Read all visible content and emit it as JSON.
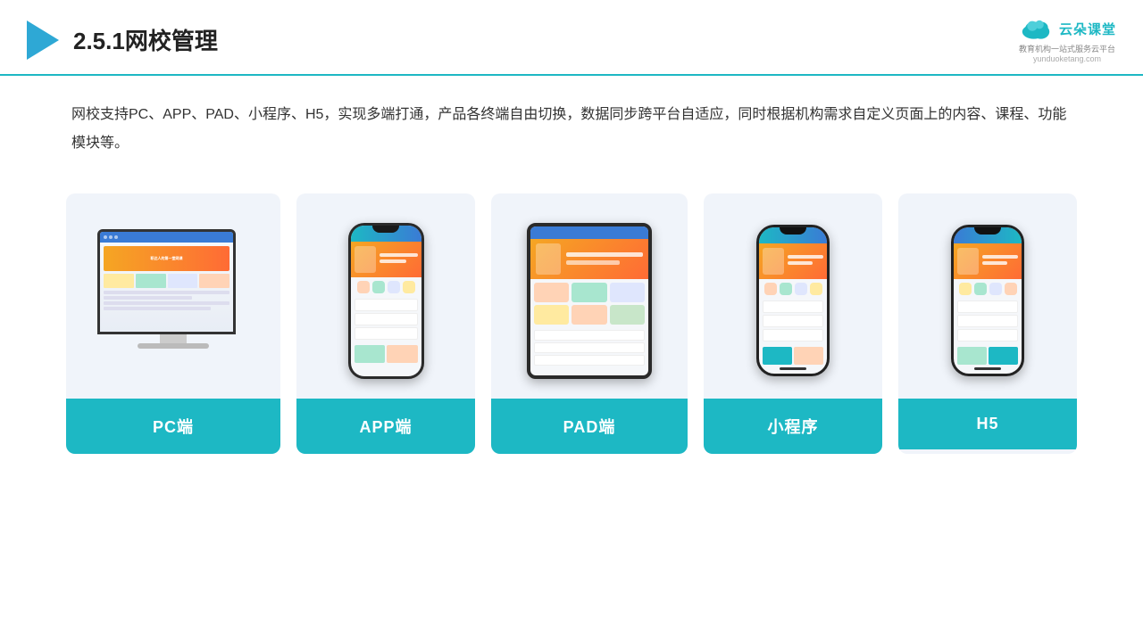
{
  "header": {
    "title": "2.5.1网校管理",
    "logo_name": "云朵课堂",
    "logo_url": "yunduoketang.com",
    "logo_tagline": "教育机构一站\n式服务云平台"
  },
  "description": {
    "text": "网校支持PC、APP、PAD、小程序、H5，实现多端打通，产品各终端自由切换，数据同步跨平台自适应，同时根据机构需求自定义页面上的内容、课程、功能模块等。"
  },
  "cards": [
    {
      "id": "pc",
      "label": "PC端",
      "type": "pc"
    },
    {
      "id": "app",
      "label": "APP端",
      "type": "phone"
    },
    {
      "id": "pad",
      "label": "PAD端",
      "type": "pad"
    },
    {
      "id": "miniprogram",
      "label": "小程序",
      "type": "phone_mini"
    },
    {
      "id": "h5",
      "label": "H5",
      "type": "phone_h5"
    }
  ],
  "colors": {
    "accent": "#1db8c4",
    "header_border": "#1db8c4",
    "card_bg": "#eef2fa",
    "label_bg": "#1db8c4"
  }
}
